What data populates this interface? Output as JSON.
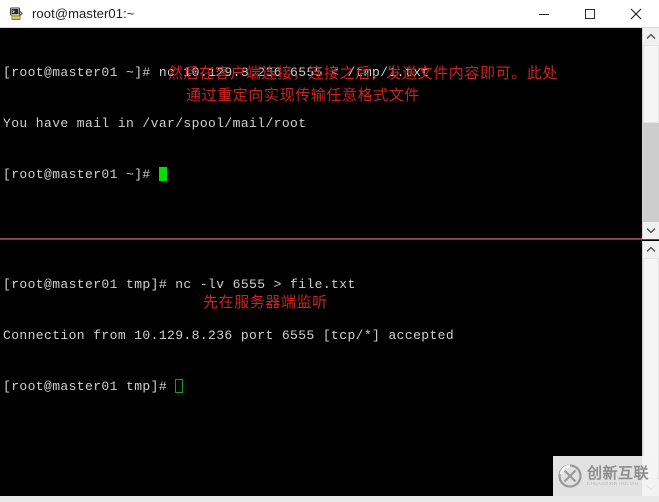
{
  "window": {
    "title": "root@master01:~",
    "icon": "putty-terminal-icon",
    "controls": {
      "minimize": "minimize-button",
      "maximize": "maximize-button",
      "close": "close-button"
    }
  },
  "colors": {
    "terminal_bg": "#000000",
    "terminal_fg": "#d0d0d0",
    "annotation_red": "#cc2222",
    "cursor_green": "#00e000",
    "divider": "#8a5050",
    "watermark_gray": "#8e8e8e"
  },
  "panes": {
    "top": {
      "name": "client-terminal-pane",
      "lines": [
        "[root@master01 ~]# nc 10.129.8.236 6555 < /tmp/1.txt",
        "You have mail in /var/spool/mail/root",
        "[root@master01 ~]# "
      ],
      "cursor": "filled",
      "annotation": {
        "line1": "然后在客户端连接，连接之后，发送文件内容即可。此处",
        "line2": "通过重定向实现传输任意格式文件"
      }
    },
    "bottom": {
      "name": "server-terminal-pane",
      "lines": [
        "[root@master01 tmp]# nc -lv 6555 > file.txt",
        "Connection from 10.129.8.236 port 6555 [tcp/*] accepted",
        "[root@master01 tmp]# "
      ],
      "cursor": "hollow",
      "annotation": {
        "line1": "先在服务器端监听"
      }
    }
  },
  "scrollbars": {
    "top": {
      "up": "scroll-up-arrow",
      "down": "scroll-down-arrow"
    },
    "bottom": {
      "up": "scroll-up-arrow",
      "down": "scroll-down-arrow"
    }
  },
  "watermark": {
    "text": "创新互联",
    "subtext": "CHUANGXIN HULIAN",
    "logo": "circle-x-logo"
  }
}
